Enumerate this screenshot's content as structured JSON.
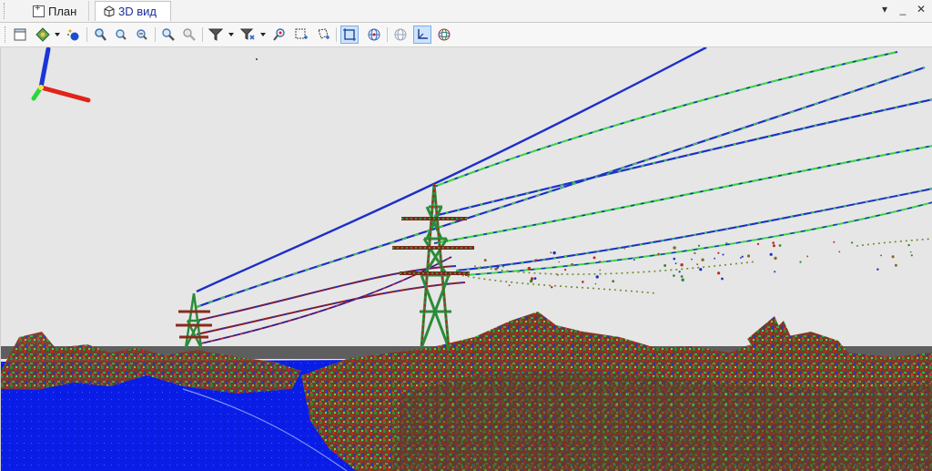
{
  "tabs": [
    {
      "label": "План",
      "icon": "plan-icon",
      "active": false
    },
    {
      "label": "3D вид",
      "icon": "cube-icon",
      "active": true
    }
  ],
  "window_controls": {
    "menu": "▾",
    "minimize": "_",
    "close": "✕"
  },
  "toolbar": {
    "buttons": [
      "view-frame-icon",
      "navigation-icon",
      "point-style-icon",
      "zoom-in-icon",
      "zoom-in-small-icon",
      "zoom-out-icon",
      "zoom-extents-icon",
      "zoom-previous-icon",
      "filter-icon",
      "filter-advanced-icon",
      "find-point-icon",
      "select-rectangle-icon",
      "select-polygon-icon",
      "crop-box-icon",
      "sphere-view-icon",
      "grid-sphere-icon",
      "axes-view-icon",
      "orbit-sphere-icon"
    ],
    "active": [
      "crop-box-icon",
      "axes-view-icon"
    ]
  },
  "scene": {
    "description_colors": {
      "ground": "#0a1de6",
      "vegetation_red": "#b3261e",
      "vegetation_green": "#2c8a3a",
      "wire_blue": "#1c2fc8",
      "wire_green": "#3fd24b",
      "background": "#e6e6e6"
    }
  }
}
